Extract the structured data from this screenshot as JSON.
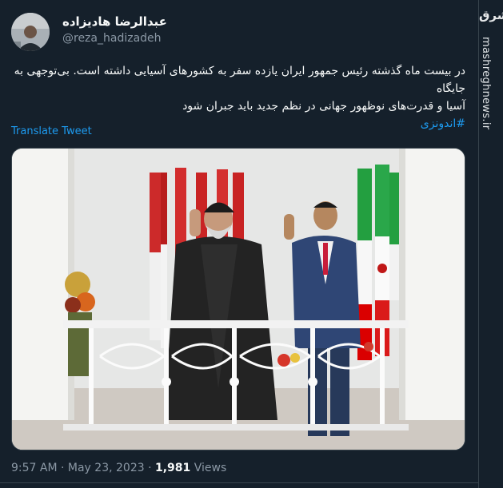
{
  "tweet": {
    "author": {
      "display_name": "عبدالرضا هادیزاده",
      "handle": "@reza_hadizadeh"
    },
    "body": {
      "line1": "در بیست ماه گذشته رئیس جمهور ایران یازده سفر به کشورهای آسیایی داشته است. بی‌توجهی به جایگاه",
      "line2": "آسیا و قدرت‌های نوظهور جهانی در نظم جدید باید جبران شود",
      "hashtag": "#اندونزی"
    },
    "translate_label": "Translate Tweet",
    "timestamp": "9:57 AM · May 23, 2023",
    "dot": " · ",
    "views_count": "1,981",
    "views_label": " Views"
  },
  "watermark": {
    "logo": "مشرق",
    "site": "mashreghnews.ir"
  },
  "colors": {
    "background": "#15202b",
    "accent": "#1d9bf0",
    "secondary_text": "#8b98a5"
  }
}
